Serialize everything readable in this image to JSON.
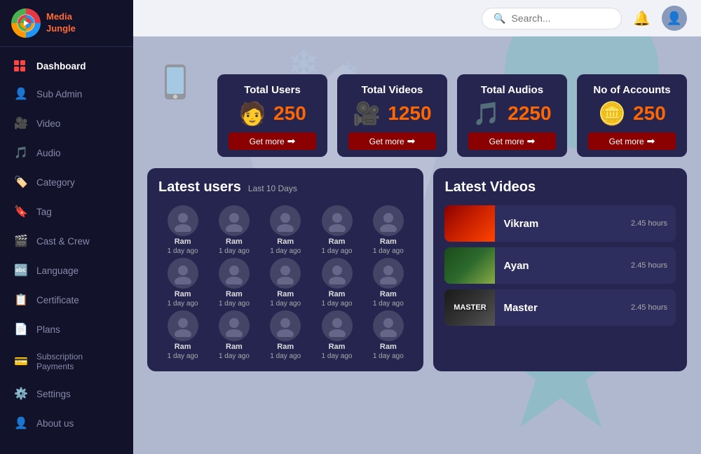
{
  "logo": {
    "text1": "Media",
    "text2": "Jungle"
  },
  "header": {
    "search_placeholder": "Search...",
    "search_value": ""
  },
  "sidebar": {
    "items": [
      {
        "id": "dashboard",
        "label": "Dashboard",
        "icon": "grid",
        "active": true
      },
      {
        "id": "sub-admin",
        "label": "Sub Admin",
        "icon": "👤"
      },
      {
        "id": "video",
        "label": "Video",
        "icon": "🎥"
      },
      {
        "id": "audio",
        "label": "Audio",
        "icon": "🎵"
      },
      {
        "id": "category",
        "label": "Category",
        "icon": "🏷️"
      },
      {
        "id": "tag",
        "label": "Tag",
        "icon": "🔖"
      },
      {
        "id": "cast-crew",
        "label": "Cast & Crew",
        "icon": "🎬"
      },
      {
        "id": "language",
        "label": "Language",
        "icon": "🔤"
      },
      {
        "id": "certificate",
        "label": "Certificate",
        "icon": "📋"
      },
      {
        "id": "plans",
        "label": "Plans",
        "icon": "📄"
      },
      {
        "id": "subscription",
        "label": "Subscription Payments",
        "icon": "💳"
      },
      {
        "id": "settings",
        "label": "Settings",
        "icon": "⚙️"
      },
      {
        "id": "about",
        "label": "About us",
        "icon": "👤"
      }
    ]
  },
  "stats": [
    {
      "id": "total-users",
      "title": "Total Users",
      "icon": "🧑",
      "value": "250",
      "link": "Get more"
    },
    {
      "id": "total-videos",
      "title": "Total Videos",
      "icon": "🎥",
      "value": "1250",
      "link": "Get more"
    },
    {
      "id": "total-audios",
      "title": "Total Audios",
      "icon": "🎵",
      "value": "2250",
      "link": "Get more"
    },
    {
      "id": "no-of-accounts",
      "title": "No of Accounts",
      "icon": "🪙",
      "value": "250",
      "link": "Get more"
    }
  ],
  "latest_users": {
    "title": "Latest users",
    "subtitle": "Last 10 Days",
    "users": [
      {
        "name": "Ram",
        "time": "1 day ago"
      },
      {
        "name": "Ram",
        "time": "1 day ago"
      },
      {
        "name": "Ram",
        "time": "1 day ago"
      },
      {
        "name": "Ram",
        "time": "1 day ago"
      },
      {
        "name": "Ram",
        "time": "1 day ago"
      },
      {
        "name": "Ram",
        "time": "1 day ago"
      },
      {
        "name": "Ram",
        "time": "1 day ago"
      },
      {
        "name": "Ram",
        "time": "1 day ago"
      },
      {
        "name": "Ram",
        "time": "1 day ago"
      },
      {
        "name": "Ram",
        "time": "1 day ago"
      },
      {
        "name": "Ram",
        "time": "1 day ago"
      },
      {
        "name": "Ram",
        "time": "1 day ago"
      },
      {
        "name": "Ram",
        "time": "1 day ago"
      },
      {
        "name": "Ram",
        "time": "1 day ago"
      },
      {
        "name": "Ram",
        "time": "1 day ago"
      }
    ]
  },
  "latest_videos": {
    "title": "Latest Videos",
    "items": [
      {
        "id": "vikram",
        "title": "Vikram",
        "duration": "2.45 hours",
        "thumb_class": "vikram",
        "thumb_text": ""
      },
      {
        "id": "ayan",
        "title": "Ayan",
        "duration": "2.45 hours",
        "thumb_class": "ayan",
        "thumb_text": ""
      },
      {
        "id": "master",
        "title": "Master",
        "duration": "2.45 hours",
        "thumb_class": "master",
        "thumb_text": "MASTER"
      }
    ]
  }
}
